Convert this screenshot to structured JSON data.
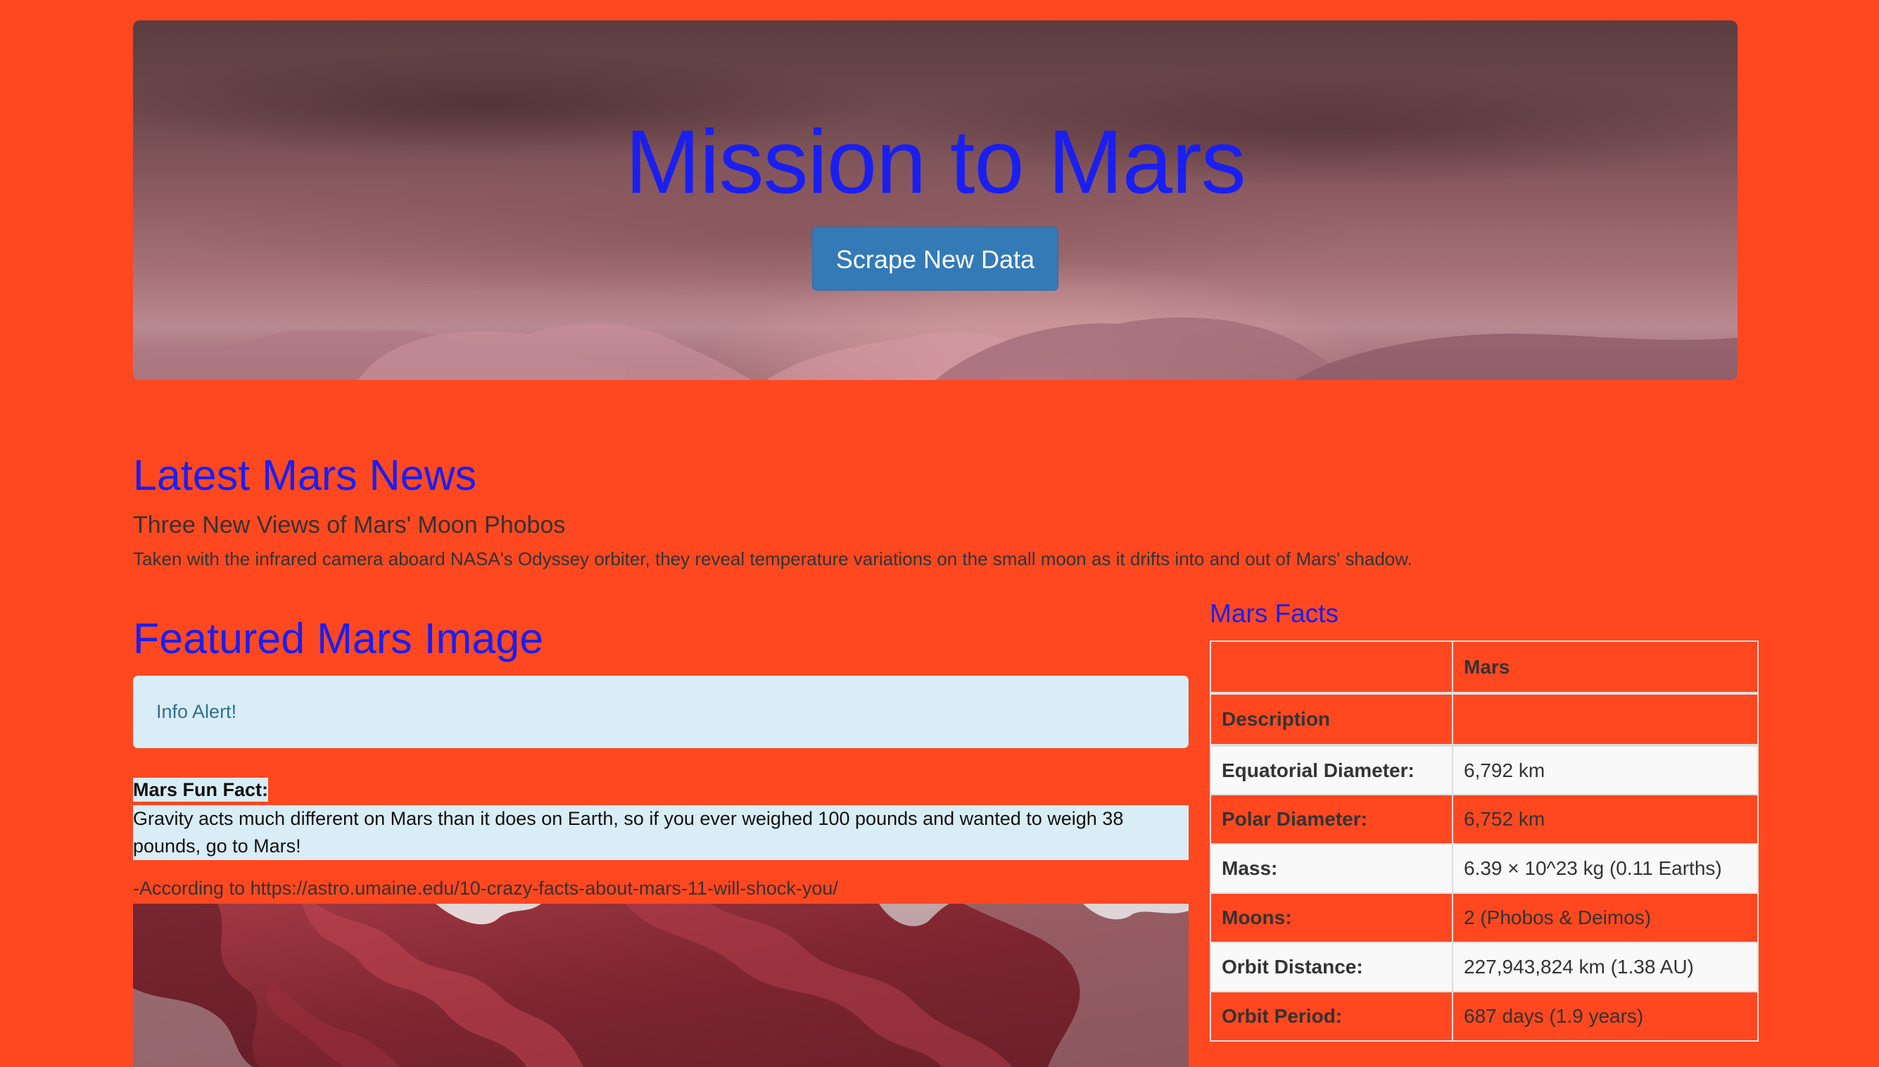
{
  "hero": {
    "title": "Mission to Mars",
    "button_label": "Scrape New Data"
  },
  "news": {
    "heading": "Latest Mars News",
    "title": "Three New Views of Mars' Moon Phobos",
    "teaser": "Taken with the infrared camera aboard NASA's Odyssey orbiter, they reveal temperature variations on the small moon as it drifts into and out of Mars' shadow."
  },
  "featured": {
    "heading": "Featured Mars Image",
    "alert": "Info Alert!",
    "fun_fact_label": "Mars Fun Fact:",
    "fun_fact_text": "Gravity acts much different on Mars than it does on Earth, so if you ever weighed 100 pounds and wanted to weigh 38 pounds, go to Mars!",
    "source": "-According to https://astro.umaine.edu/10-crazy-facts-about-mars-11-will-shock-you/"
  },
  "facts": {
    "heading": "Mars Facts",
    "header": [
      "",
      "Mars"
    ],
    "index_label": "Description",
    "rows": [
      {
        "label": "Equatorial Diameter:",
        "value": "6,792 km"
      },
      {
        "label": "Polar Diameter:",
        "value": "6,752 km"
      },
      {
        "label": "Mass:",
        "value": "6.39 × 10^23 kg (0.11 Earths)"
      },
      {
        "label": "Moons:",
        "value": "2 (Phobos & Deimos)"
      },
      {
        "label": "Orbit Distance:",
        "value": "227,943,824 km (1.38 AU)"
      },
      {
        "label": "Orbit Period:",
        "value": "687 days (1.9 years)"
      }
    ]
  },
  "colors": {
    "page_background": "#ff4820",
    "heading_blue": "#1a1ff0",
    "button_blue": "#337ab7",
    "alert_background": "#d9edf7",
    "alert_text": "#31708f"
  }
}
